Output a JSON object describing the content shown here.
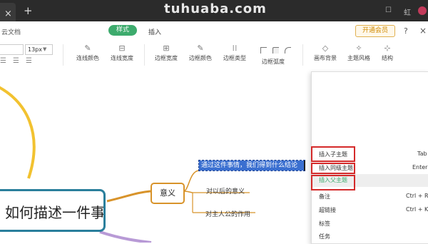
{
  "watermark": "tuhuaba.com",
  "titlebar": {
    "tab_close": "×",
    "new_tab": "+",
    "icon_a": "☐",
    "icon_b": "虹"
  },
  "menubar": {
    "doc_name": "云文档",
    "tab_style": "样式",
    "tab_insert": "插入",
    "member_button": "开通会员",
    "help": "?",
    "close": "×"
  },
  "toolbar": {
    "font_family": "",
    "font_size": "13px",
    "tools": [
      {
        "label": "连线颜色",
        "icon": "✎"
      },
      {
        "label": "连线宽度",
        "icon": "⊟"
      },
      {
        "label": "边框宽度",
        "icon": "⊞"
      },
      {
        "label": "边框颜色",
        "icon": "✎"
      },
      {
        "label": "边框类型",
        "icon": "⁞⁞"
      },
      {
        "label": "边框弧度",
        "icon": ""
      },
      {
        "label": "画布背景",
        "icon": "◇"
      },
      {
        "label": "主题风格",
        "icon": "✧"
      },
      {
        "label": "结构",
        "icon": "⊹"
      }
    ]
  },
  "canvas": {
    "central_topic": "如何描述一件事情",
    "node_meaning": "意义",
    "selected_text": "通过这件事情，我们得到什么结论",
    "child_1": "对以后的意义",
    "child_2": "对主人公的作用"
  },
  "context_menu": {
    "items": [
      {
        "label": "插入子主题",
        "shortcut": "Tab"
      },
      {
        "label": "插入同级主题",
        "shortcut": "Enter"
      },
      {
        "label": "插入父主题",
        "shortcut": ""
      },
      {
        "label": "备注",
        "shortcut": "Ctrl + R"
      },
      {
        "label": "超链接",
        "shortcut": "Ctrl + K"
      },
      {
        "label": "标签",
        "shortcut": ""
      },
      {
        "label": "任务",
        "shortcut": ""
      }
    ]
  },
  "colors": {
    "central_border": "#2a7f9c",
    "branch_orange": "#d8932a",
    "branch_yellow": "#f2c230",
    "branch_purple": "#b89ad6",
    "accent_green": "#3dab6d",
    "annotation_red": "#d42a2a",
    "selection_blue": "#3a6fd0"
  }
}
